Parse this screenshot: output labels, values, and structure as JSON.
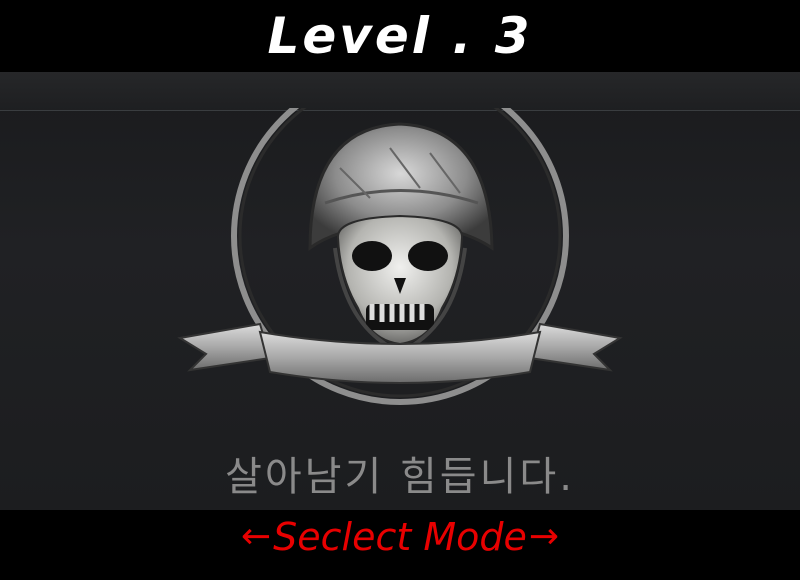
{
  "header": {
    "level_title": "Level . 3"
  },
  "emblem": {
    "icon": "skull-helmet-emblem-icon"
  },
  "difficulty": {
    "description": "살아남기 힘듭니다."
  },
  "mode_selector": {
    "left_arrow": "←",
    "label": "Seclect Mode",
    "right_arrow": "→",
    "color": "#e80000"
  }
}
